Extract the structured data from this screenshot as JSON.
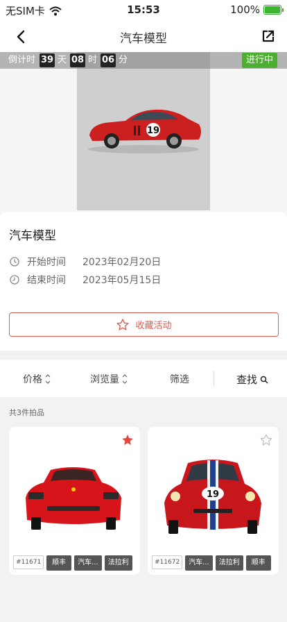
{
  "status_bar": {
    "carrier": "无SIM卡",
    "time": "15:53",
    "battery": "100%"
  },
  "nav": {
    "title": "汽车模型"
  },
  "countdown": {
    "label": "倒计时",
    "days": "39",
    "day_unit": "天",
    "hours": "08",
    "hour_unit": "时",
    "minutes": "06",
    "minute_unit": "分",
    "status": "进行中"
  },
  "hero": {
    "car_number": "19"
  },
  "info": {
    "title": "汽车模型",
    "start_label": "开始时间",
    "start_value": "2023年02月20日",
    "end_label": "结束时间",
    "end_value": "2023年05月15日",
    "favorite_label": "收藏活动"
  },
  "sort": {
    "price": "价格",
    "views": "浏览量",
    "filter": "筛选",
    "search": "查找"
  },
  "lots_count": "共3件拍品",
  "lots": [
    {
      "id": "#11671",
      "tags": [
        "顺丰",
        "汽车...",
        "法拉利"
      ],
      "favorited": true
    },
    {
      "id": "#11672",
      "tags": [
        "汽车...",
        "法拉利",
        "顺丰"
      ],
      "favorited": false,
      "car_number": "19"
    }
  ],
  "colors": {
    "accent": "#e05a4f",
    "status_green": "#4caf32",
    "star_red": "#e8453c"
  }
}
